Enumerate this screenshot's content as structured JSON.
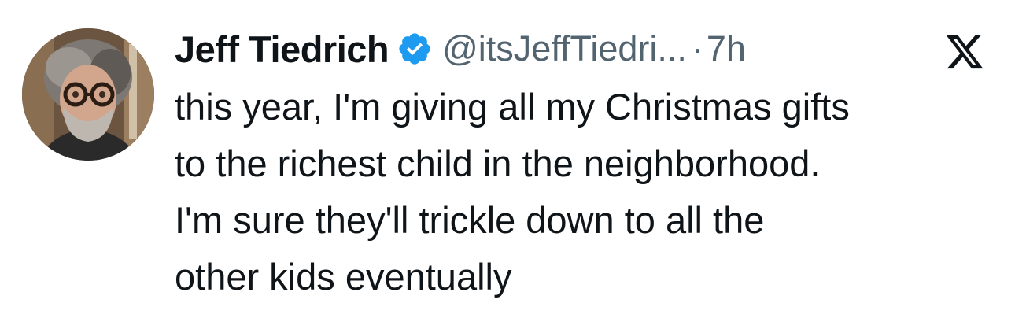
{
  "tweet": {
    "author": {
      "display_name": "Jeff Tiedrich",
      "handle": "@itsJeffTiedri...",
      "verified_icon": "verified-badge-icon",
      "avatar_icon": "avatar-photo"
    },
    "separator": "·",
    "time_ago": "7h",
    "platform_icon": "x-logo-icon",
    "text_lines": [
      "this year, I'm giving all my Christmas gifts",
      "to the richest child in the neighborhood.",
      "I'm sure they'll trickle down to all the",
      "other kids eventually"
    ]
  },
  "colors": {
    "text": "#0f1419",
    "muted": "#536471",
    "verified_blue": "#1d9bf0",
    "background": "#ffffff"
  }
}
